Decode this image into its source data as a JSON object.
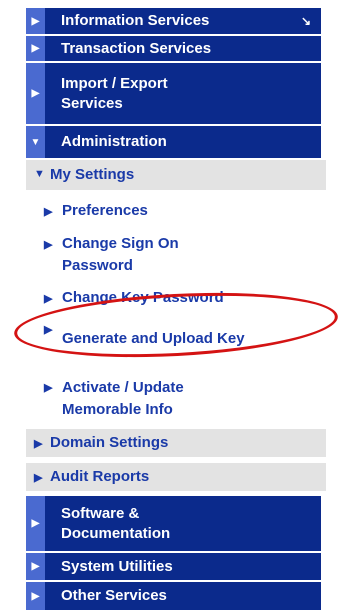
{
  "menu": {
    "top1": {
      "label": "Information Services",
      "ext_icon": "external-link-icon"
    },
    "top2": {
      "label": "Transaction Services"
    },
    "top3": {
      "label": "Import / Export Services"
    },
    "admin": {
      "label": "Administration"
    },
    "my_settings": {
      "label": "My Settings"
    },
    "preferences": {
      "label": "Preferences"
    },
    "change_signon": {
      "label": "Change Sign On Password"
    },
    "change_key": {
      "label": "Change Key Password"
    },
    "generate_upload": {
      "label": "Generate and Upload Key"
    },
    "activate_update": {
      "label": "Activate / Update Memorable Info"
    },
    "domain_settings": {
      "label": "Domain Settings"
    },
    "audit_reports": {
      "label": "Audit Reports"
    },
    "software_docs": {
      "label": "Software & Documentation"
    },
    "system_utilities": {
      "label": "System Utilities"
    },
    "other_services": {
      "label": "Other Services"
    }
  },
  "colors": {
    "top_bg": "#0b2a8c",
    "arrow_bg": "#4a6ad0",
    "sub_bg": "#e3e3e3",
    "link_text": "#1a3aa8",
    "highlight": "#d41313"
  },
  "icons": {
    "collapsed": "triangle-right-icon",
    "expanded": "triangle-down-icon"
  }
}
